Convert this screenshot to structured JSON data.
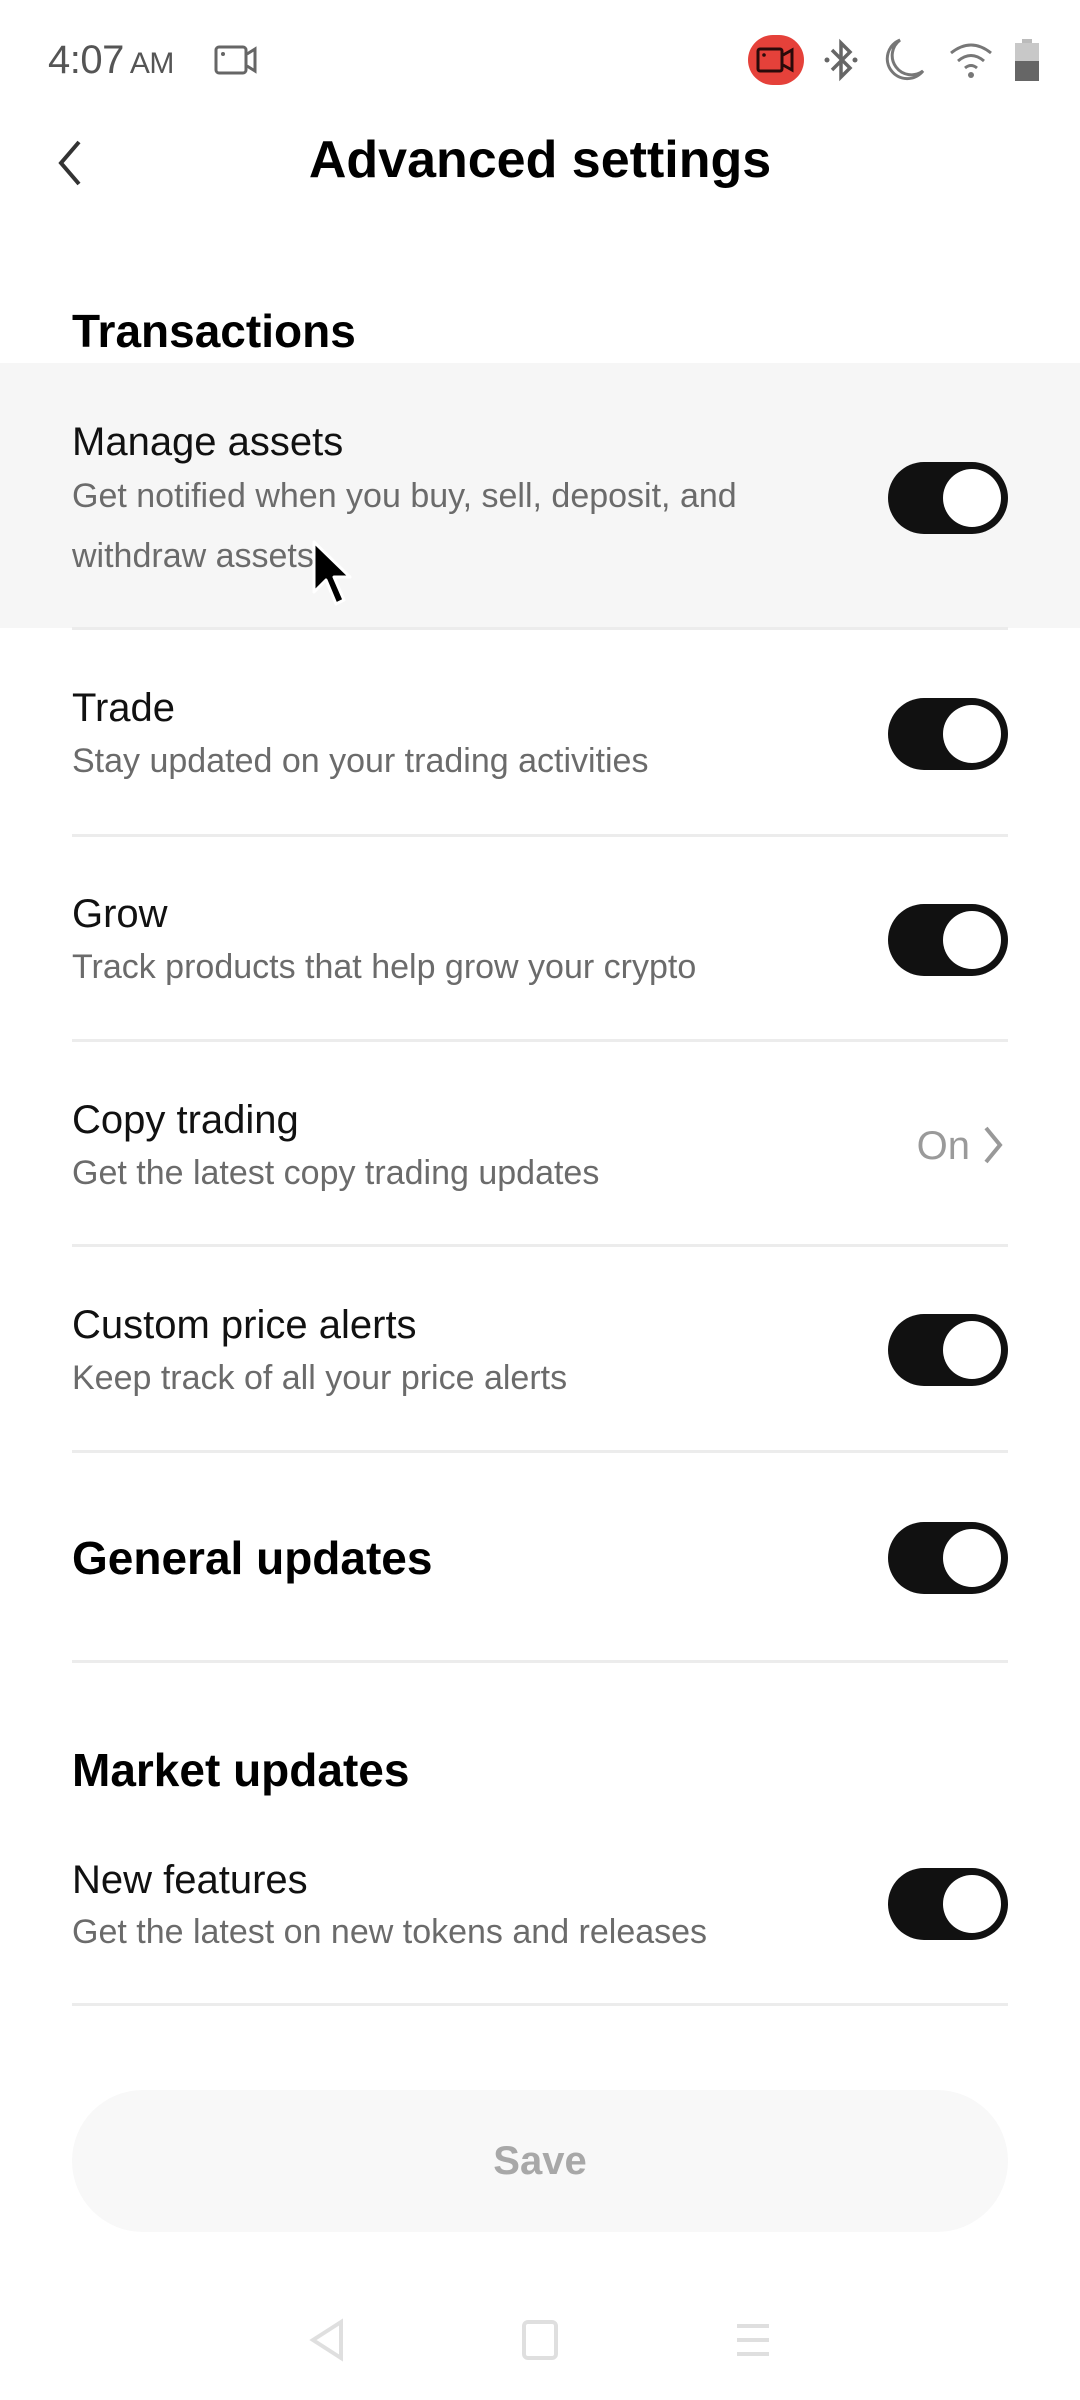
{
  "status_bar": {
    "time": "4:07",
    "ampm": "AM",
    "icons": [
      "screen-record-icon",
      "screen-record-active-icon",
      "bluetooth-icon",
      "do-not-disturb-moon-icon",
      "wifi-icon",
      "battery-icon"
    ],
    "record_color": "#e5413a"
  },
  "header": {
    "back_icon": "chevron-left-icon",
    "title": "Advanced settings"
  },
  "sections": {
    "transactions": {
      "heading": "Transactions",
      "items": [
        {
          "title": "Manage assets",
          "subtitle_line1": "Get notified when you buy, sell, deposit, and",
          "subtitle_line2": "withdraw assets",
          "control": "toggle",
          "enabled": true,
          "highlighted": true
        },
        {
          "title": "Trade",
          "subtitle": "Stay updated on your trading activities",
          "control": "toggle",
          "enabled": true
        },
        {
          "title": "Grow",
          "subtitle": "Track products that help grow your crypto",
          "control": "toggle",
          "enabled": true
        },
        {
          "title": "Copy trading",
          "subtitle": "Get the latest copy trading updates",
          "control": "link",
          "value": "On"
        },
        {
          "title": "Custom price alerts",
          "subtitle": "Keep track of all your price alerts",
          "control": "toggle",
          "enabled": true
        }
      ]
    },
    "general": {
      "heading": "General updates",
      "control": "toggle",
      "enabled": true
    },
    "market": {
      "heading": "Market updates",
      "items": [
        {
          "title": "New features",
          "subtitle": "Get the latest on new tokens and releases",
          "control": "toggle",
          "enabled": true
        }
      ]
    }
  },
  "footer": {
    "save_label": "Save"
  },
  "system_nav": [
    "back-nav-icon",
    "home-nav-icon",
    "recents-nav-icon"
  ],
  "colors": {
    "toggle_on": "#111111",
    "subtitle": "#6b6b6b",
    "divider": "#ececec",
    "row_highlight": "#f6f6f6",
    "save_bg": "#f8f8f8",
    "save_text": "#a8a8a8"
  }
}
